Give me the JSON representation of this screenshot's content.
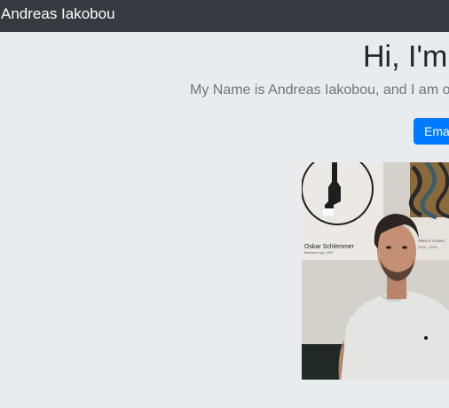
{
  "navbar": {
    "brand": "Andreas Iakobou"
  },
  "hero": {
    "heading": "Hi, I'm",
    "lead": "My Name is Andreas Iakobou, and I am on",
    "email_button": "Email"
  },
  "photo": {
    "poster_name": "Oskar Schlemmer",
    "poster_small": "Bauhaus Logo, 1922",
    "poster_right": "FRED K YOUNG",
    "poster_right_small": "2016 - 2019"
  }
}
